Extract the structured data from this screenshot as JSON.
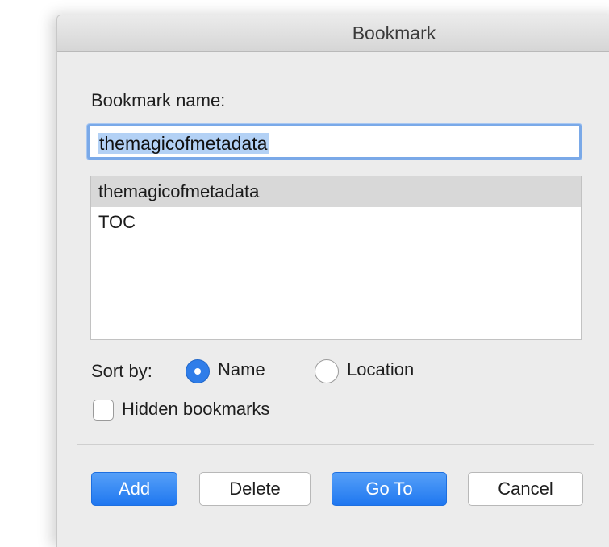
{
  "window": {
    "title": "Bookmark"
  },
  "form": {
    "name_label": "Bookmark name:",
    "name_value": "themagicofmetadata"
  },
  "bookmarks": {
    "items": [
      {
        "label": "themagicofmetadata",
        "selected": true
      },
      {
        "label": "TOC",
        "selected": false
      }
    ]
  },
  "sort": {
    "label": "Sort by:",
    "options": [
      {
        "label": "Name",
        "checked": true
      },
      {
        "label": "Location",
        "checked": false
      }
    ]
  },
  "hidden_bookmarks": {
    "label": "Hidden bookmarks",
    "checked": false
  },
  "buttons": {
    "add": "Add",
    "delete": "Delete",
    "goto": "Go To",
    "cancel": "Cancel"
  },
  "colors": {
    "accent": "#2f7de9",
    "selection": "#b3d1f5",
    "list_selected": "#d8d8d8",
    "dialog_bg": "#ececec"
  }
}
